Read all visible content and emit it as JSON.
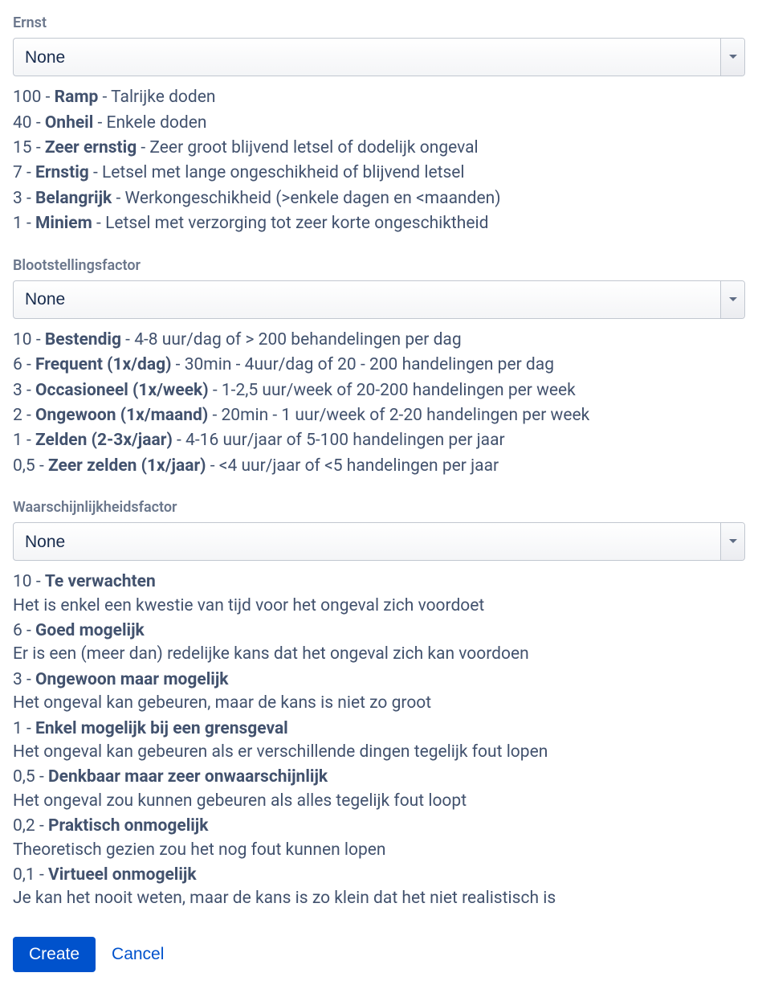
{
  "fields": {
    "ernst": {
      "label": "Ernst",
      "selected": "None",
      "items": [
        {
          "num": "100",
          "name": "Ramp",
          "desc": "Talrijke doden"
        },
        {
          "num": "40",
          "name": "Onheil",
          "desc": "Enkele doden"
        },
        {
          "num": "15",
          "name": "Zeer ernstig",
          "desc": "Zeer groot blijvend letsel of dodelijk ongeval"
        },
        {
          "num": "7",
          "name": "Ernstig",
          "desc": "Letsel met lange ongeschikheid of blijvend letsel"
        },
        {
          "num": "3",
          "name": "Belangrijk",
          "desc": "Werkongeschikheid (>enkele dagen en <maanden)"
        },
        {
          "num": "1",
          "name": "Miniem",
          "desc": "Letsel met verzorging tot zeer korte ongeschiktheid"
        }
      ]
    },
    "blootstelling": {
      "label": "Blootstellingsfactor",
      "selected": "None",
      "items": [
        {
          "num": "10",
          "name": "Bestendig",
          "desc": "4-8 uur/dag of > 200 behandelingen per dag"
        },
        {
          "num": "6",
          "name": "Frequent (1x/dag)",
          "desc": "30min - 4uur/dag of 20 - 200 handelingen per dag"
        },
        {
          "num": "3",
          "name": "Occasioneel (1x/week)",
          "desc": "1-2,5 uur/week of 20-200 handelingen per week"
        },
        {
          "num": "2",
          "name": "Ongewoon (1x/maand)",
          "desc": "20min - 1 uur/week of 2-20 handelingen per week"
        },
        {
          "num": "1",
          "name": "Zelden (2-3x/jaar)",
          "desc": "4-16 uur/jaar of 5-100 handelingen per jaar"
        },
        {
          "num": "0,5",
          "name": "Zeer zelden (1x/jaar)",
          "desc": "<4 uur/jaar of <5 handelingen per jaar"
        }
      ]
    },
    "waarschijnlijkheid": {
      "label": "Waarschijnlijkheidsfactor",
      "selected": "None",
      "items": [
        {
          "num": "10",
          "name": "Te verwachten",
          "desc": "Het is enkel een kwestie van tijd voor het ongeval zich voordoet"
        },
        {
          "num": "6",
          "name": "Goed mogelijk",
          "desc": "Er is een (meer dan) redelijke kans dat het ongeval zich kan voordoen"
        },
        {
          "num": "3",
          "name": "Ongewoon maar mogelijk",
          "desc": "Het ongeval kan gebeuren, maar de kans is niet zo groot"
        },
        {
          "num": "1",
          "name": "Enkel mogelijk bij een grensgeval",
          "desc": "Het ongeval kan gebeuren als er verschillende dingen tegelijk fout lopen"
        },
        {
          "num": "0,5",
          "name": "Denkbaar maar zeer onwaarschijnlijk",
          "desc": "Het ongeval zou kunnen gebeuren als alles tegelijk fout loopt"
        },
        {
          "num": "0,2",
          "name": "Praktisch onmogelijk",
          "desc": "Theoretisch gezien zou het nog fout kunnen lopen"
        },
        {
          "num": "0,1",
          "name": "Virtueel onmogelijk",
          "desc": "Je kan het nooit weten, maar de kans is zo klein dat het niet realistisch is"
        }
      ]
    }
  },
  "buttons": {
    "create": "Create",
    "cancel": "Cancel"
  }
}
